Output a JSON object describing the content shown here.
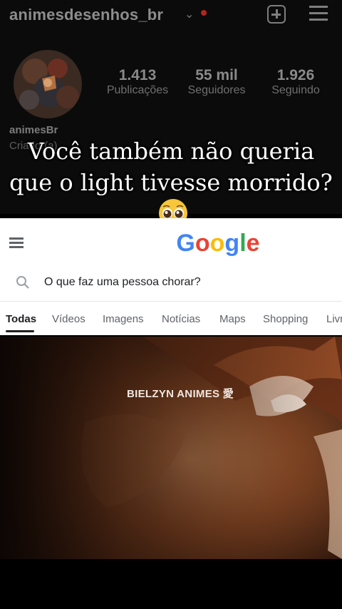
{
  "instagram": {
    "username": "animesdesenhos_br",
    "stats": [
      {
        "value": "1.413",
        "label": "Publicações"
      },
      {
        "value": "55 mil",
        "label": "Seguidores"
      },
      {
        "value": "1.926",
        "label": "Seguindo"
      }
    ],
    "bio_name": "animesBr",
    "bio_category": "Criador(a)"
  },
  "caption": {
    "line1": "Você também não queria",
    "line2": "que o light tivesse morrido?"
  },
  "google": {
    "logo": "Google",
    "query": "O que faz uma pessoa chorar?",
    "tabs": [
      "Todas",
      "Vídeos",
      "Imagens",
      "Notícias",
      "Maps",
      "Shopping",
      "Livros"
    ]
  },
  "video": {
    "watermark": "BIELZYN ANIMES 愛"
  },
  "colors": {
    "google_blue": "#4285F4",
    "google_red": "#EA4335",
    "google_yellow": "#FBBC05",
    "google_green": "#34A853"
  }
}
